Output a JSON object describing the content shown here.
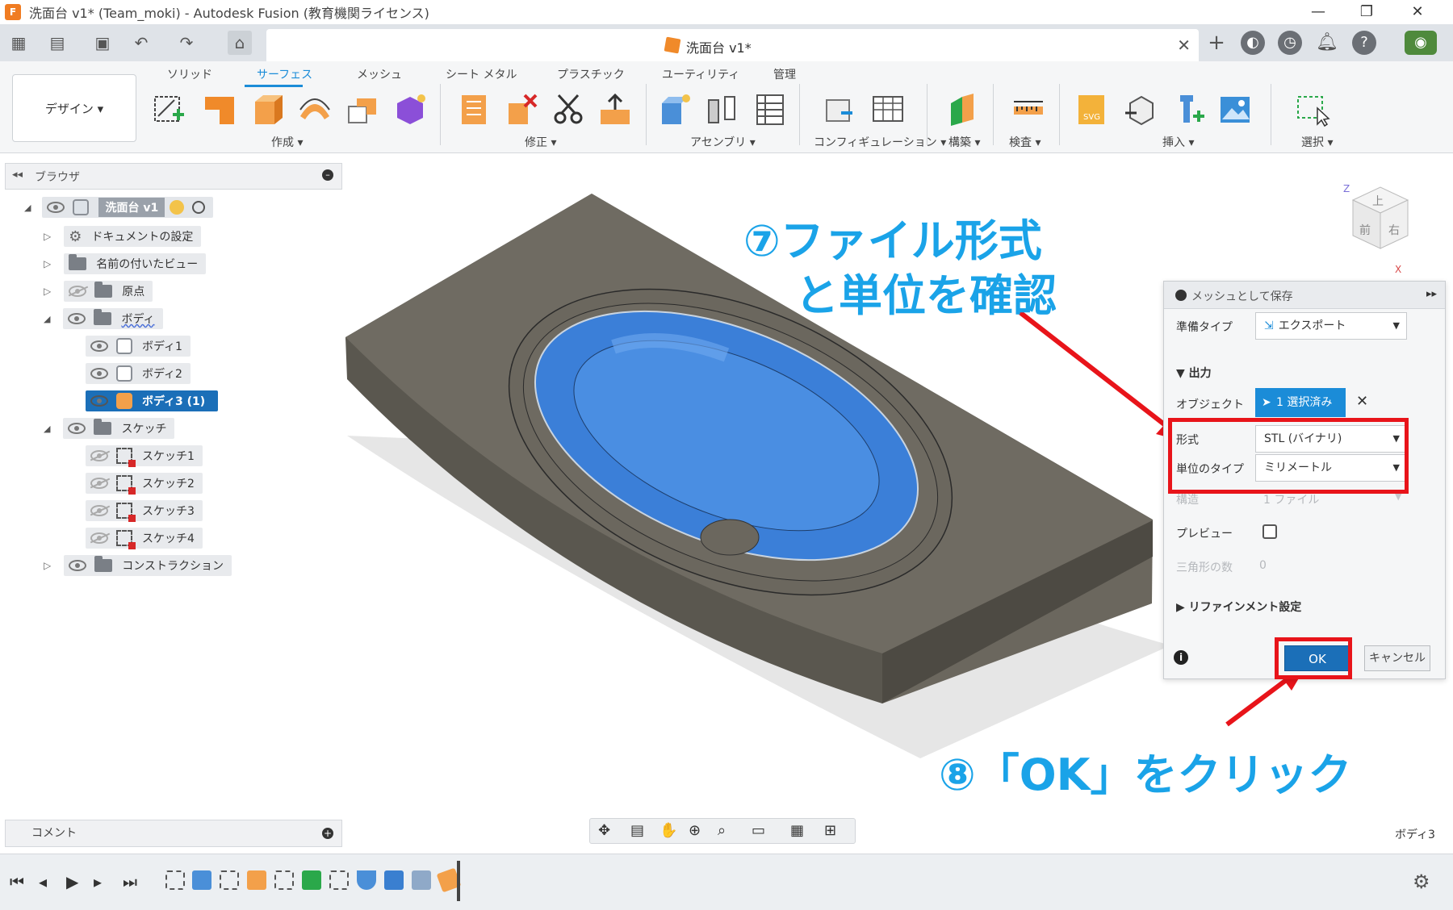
{
  "window": {
    "title": "洗面台 v1* (Team_moki) - Autodesk Fusion (教育機関ライセンス)",
    "logo_text": "F",
    "minimize_glyph": "—",
    "maximize_glyph": "❐",
    "close_glyph": "✕"
  },
  "document_tab": {
    "label": "洗面台 v1*",
    "close_glyph": "✕"
  },
  "ribbon": {
    "tabs": [
      {
        "label": "ソリッド",
        "active": false
      },
      {
        "label": "サーフェス",
        "active": true
      },
      {
        "label": "メッシュ",
        "active": false
      },
      {
        "label": "シート メタル",
        "active": false
      },
      {
        "label": "プラスチック",
        "active": false
      },
      {
        "label": "ユーティリティ",
        "active": false
      },
      {
        "label": "管理",
        "active": false
      }
    ],
    "workspace_button": "デザイン ▾",
    "groups": [
      {
        "label": "作成 ▾"
      },
      {
        "label": "修正 ▾"
      },
      {
        "label": "アセンブリ ▾"
      },
      {
        "label": "コンフィギュレーション ▾"
      },
      {
        "label": "構築 ▾"
      },
      {
        "label": "検査 ▾"
      },
      {
        "label": "挿入 ▾"
      },
      {
        "label": "選択 ▾"
      }
    ]
  },
  "browser": {
    "title": "ブラウザ",
    "root": "洗面台 v1",
    "items": [
      {
        "label": "ドキュメントの設定"
      },
      {
        "label": "名前の付いたビュー"
      },
      {
        "label": "原点"
      },
      {
        "label": "ボディ"
      },
      {
        "label": "ボディ1"
      },
      {
        "label": "ボディ2"
      },
      {
        "label": "ボディ3 (1)"
      },
      {
        "label": "スケッチ"
      },
      {
        "label": "スケッチ1"
      },
      {
        "label": "スケッチ2"
      },
      {
        "label": "スケッチ3"
      },
      {
        "label": "スケッチ4"
      },
      {
        "label": "コンストラクション"
      }
    ]
  },
  "viewcube": {
    "top": "上",
    "front": "前",
    "right": "右",
    "axis_z": "Z",
    "axis_x": "X"
  },
  "annotations": {
    "step7_line1": "⑦ファイル形式",
    "step7_line2": "と単位を確認",
    "step8": "⑧「OK」をクリック"
  },
  "dialog": {
    "title": "メッシュとして保存",
    "prep_type_label": "準備タイプ",
    "prep_type_value": "エクスポート",
    "output_section": "出力",
    "object_label": "オブジェクト",
    "object_value": "1 選択済み",
    "format_label": "形式",
    "format_value": "STL (バイナリ)",
    "unit_label": "単位のタイプ",
    "unit_value": "ミリメートル",
    "structure_label": "構造",
    "structure_value": "1 ファイル",
    "preview_label": "プレビュー",
    "triangle_label": "三角形の数",
    "triangle_value": "0",
    "refinement_label": "リファインメント設定",
    "ok_label": "OK",
    "cancel_label": "キャンセル"
  },
  "comments": {
    "label": "コメント"
  },
  "status": {
    "selection": "ボディ3"
  },
  "colors": {
    "accent": "#1b8cd8",
    "annotation": "#1aa3e8",
    "highlight": "#e8141a",
    "body_top": "#6f6b62",
    "basin": "#3b7fd8"
  }
}
